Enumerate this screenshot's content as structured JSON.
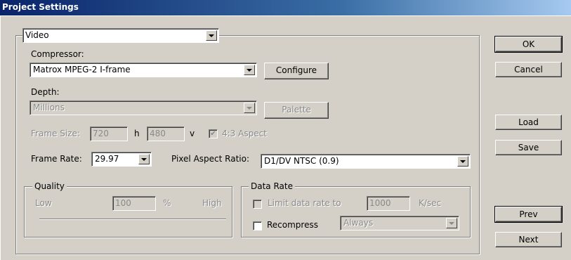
{
  "window": {
    "title": "Project Settings"
  },
  "section_select": {
    "value": "Video"
  },
  "compressor": {
    "label": "Compressor:",
    "value": "Matrox MPEG-2 I-frame",
    "configure_label": "Configure"
  },
  "depth": {
    "label": "Depth:",
    "value": "Millions",
    "palette_label": "Palette"
  },
  "frame_size": {
    "label": "Frame Size:",
    "width": "720",
    "h_label": "h",
    "height": "480",
    "v_label": "v",
    "aspect_label": "4:3 Aspect",
    "aspect_checked": true
  },
  "frame_rate": {
    "label": "Frame Rate:",
    "value": "29.97"
  },
  "pixel_aspect": {
    "label": "Pixel Aspect Ratio:",
    "value": "D1/DV NTSC (0.9)"
  },
  "quality": {
    "legend": "Quality",
    "low": "Low",
    "value": "100",
    "unit": "%",
    "high": "High"
  },
  "data_rate": {
    "legend": "Data Rate",
    "limit_label": "Limit data rate to",
    "limit_checked": false,
    "limit_value": "1000",
    "unit": "K/sec",
    "recompress_label": "Recompress",
    "recompress_checked": false,
    "recompress_value": "Always"
  },
  "buttons": {
    "ok": "OK",
    "cancel": "Cancel",
    "load": "Load",
    "save": "Save",
    "prev": "Prev",
    "next": "Next"
  }
}
